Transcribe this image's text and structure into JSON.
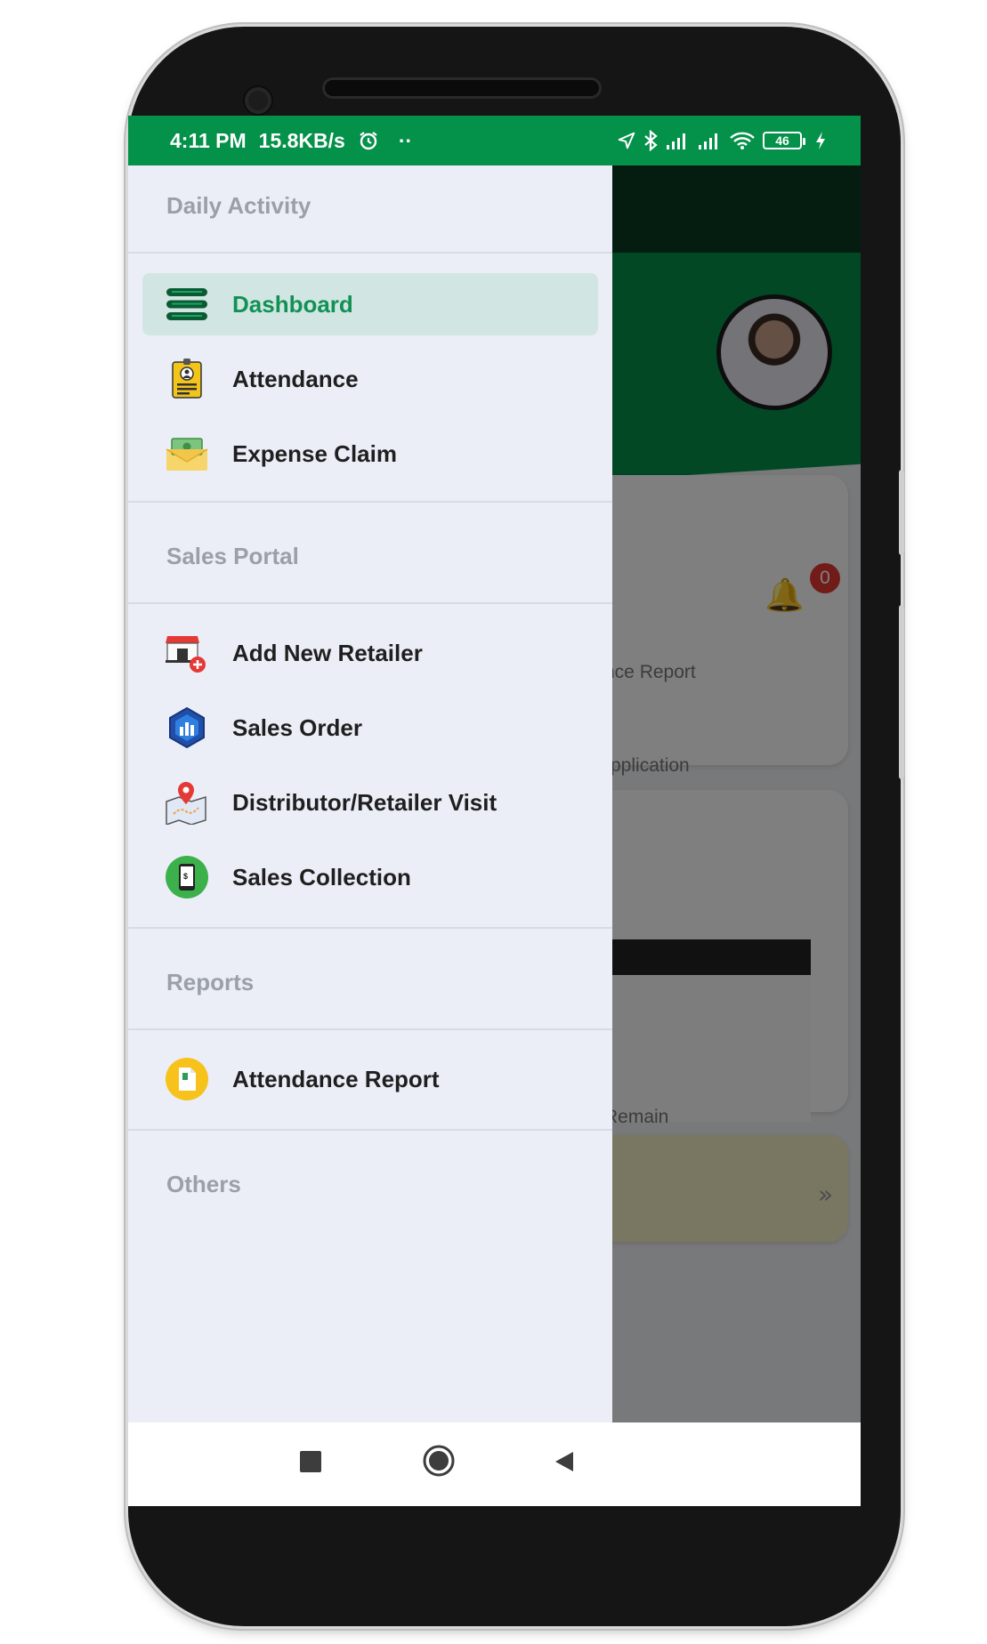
{
  "status_bar": {
    "time": "4:11 PM",
    "network_speed": "15.8KB/s",
    "dots": "··",
    "battery_level": "46",
    "icons": [
      "alarm-icon",
      "location-arrow-icon",
      "bluetooth-icon",
      "signal-icon",
      "signal-icon",
      "wifi-icon",
      "battery-icon",
      "charging-icon"
    ]
  },
  "drawer": {
    "sections": [
      {
        "header": "Daily Activity",
        "items": [
          {
            "label": "Dashboard",
            "icon": "dashboard-stack-icon",
            "active": true
          },
          {
            "label": "Attendance",
            "icon": "attendance-id-card-icon"
          },
          {
            "label": "Expense Claim",
            "icon": "expense-envelope-icon"
          }
        ]
      },
      {
        "header": "Sales Portal",
        "items": [
          {
            "label": "Add New Retailer",
            "icon": "add-retailer-store-icon"
          },
          {
            "label": "Sales Order",
            "icon": "sales-order-hexagon-icon"
          },
          {
            "label": "Distributor/Retailer Visit",
            "icon": "map-pin-icon"
          },
          {
            "label": "Sales Collection",
            "icon": "mobile-payment-icon"
          }
        ]
      },
      {
        "header": "Reports",
        "items": [
          {
            "label": "Attendance Report",
            "icon": "report-document-icon"
          }
        ]
      },
      {
        "header": "Others",
        "items": []
      }
    ]
  },
  "background": {
    "notification_count": "0",
    "card_label_1": "nce Report",
    "card_label_2": "pplication",
    "card_label_3": "Remain"
  },
  "colors": {
    "brand_green": "#04914a",
    "active_item_bg": "#d1e6e3",
    "active_item_text": "#129154",
    "drawer_bg": "#ebeef7",
    "section_header": "#9aa0a6"
  },
  "nav_bar": {
    "buttons": [
      "recents-square-icon",
      "home-circle-icon",
      "back-triangle-icon"
    ]
  }
}
